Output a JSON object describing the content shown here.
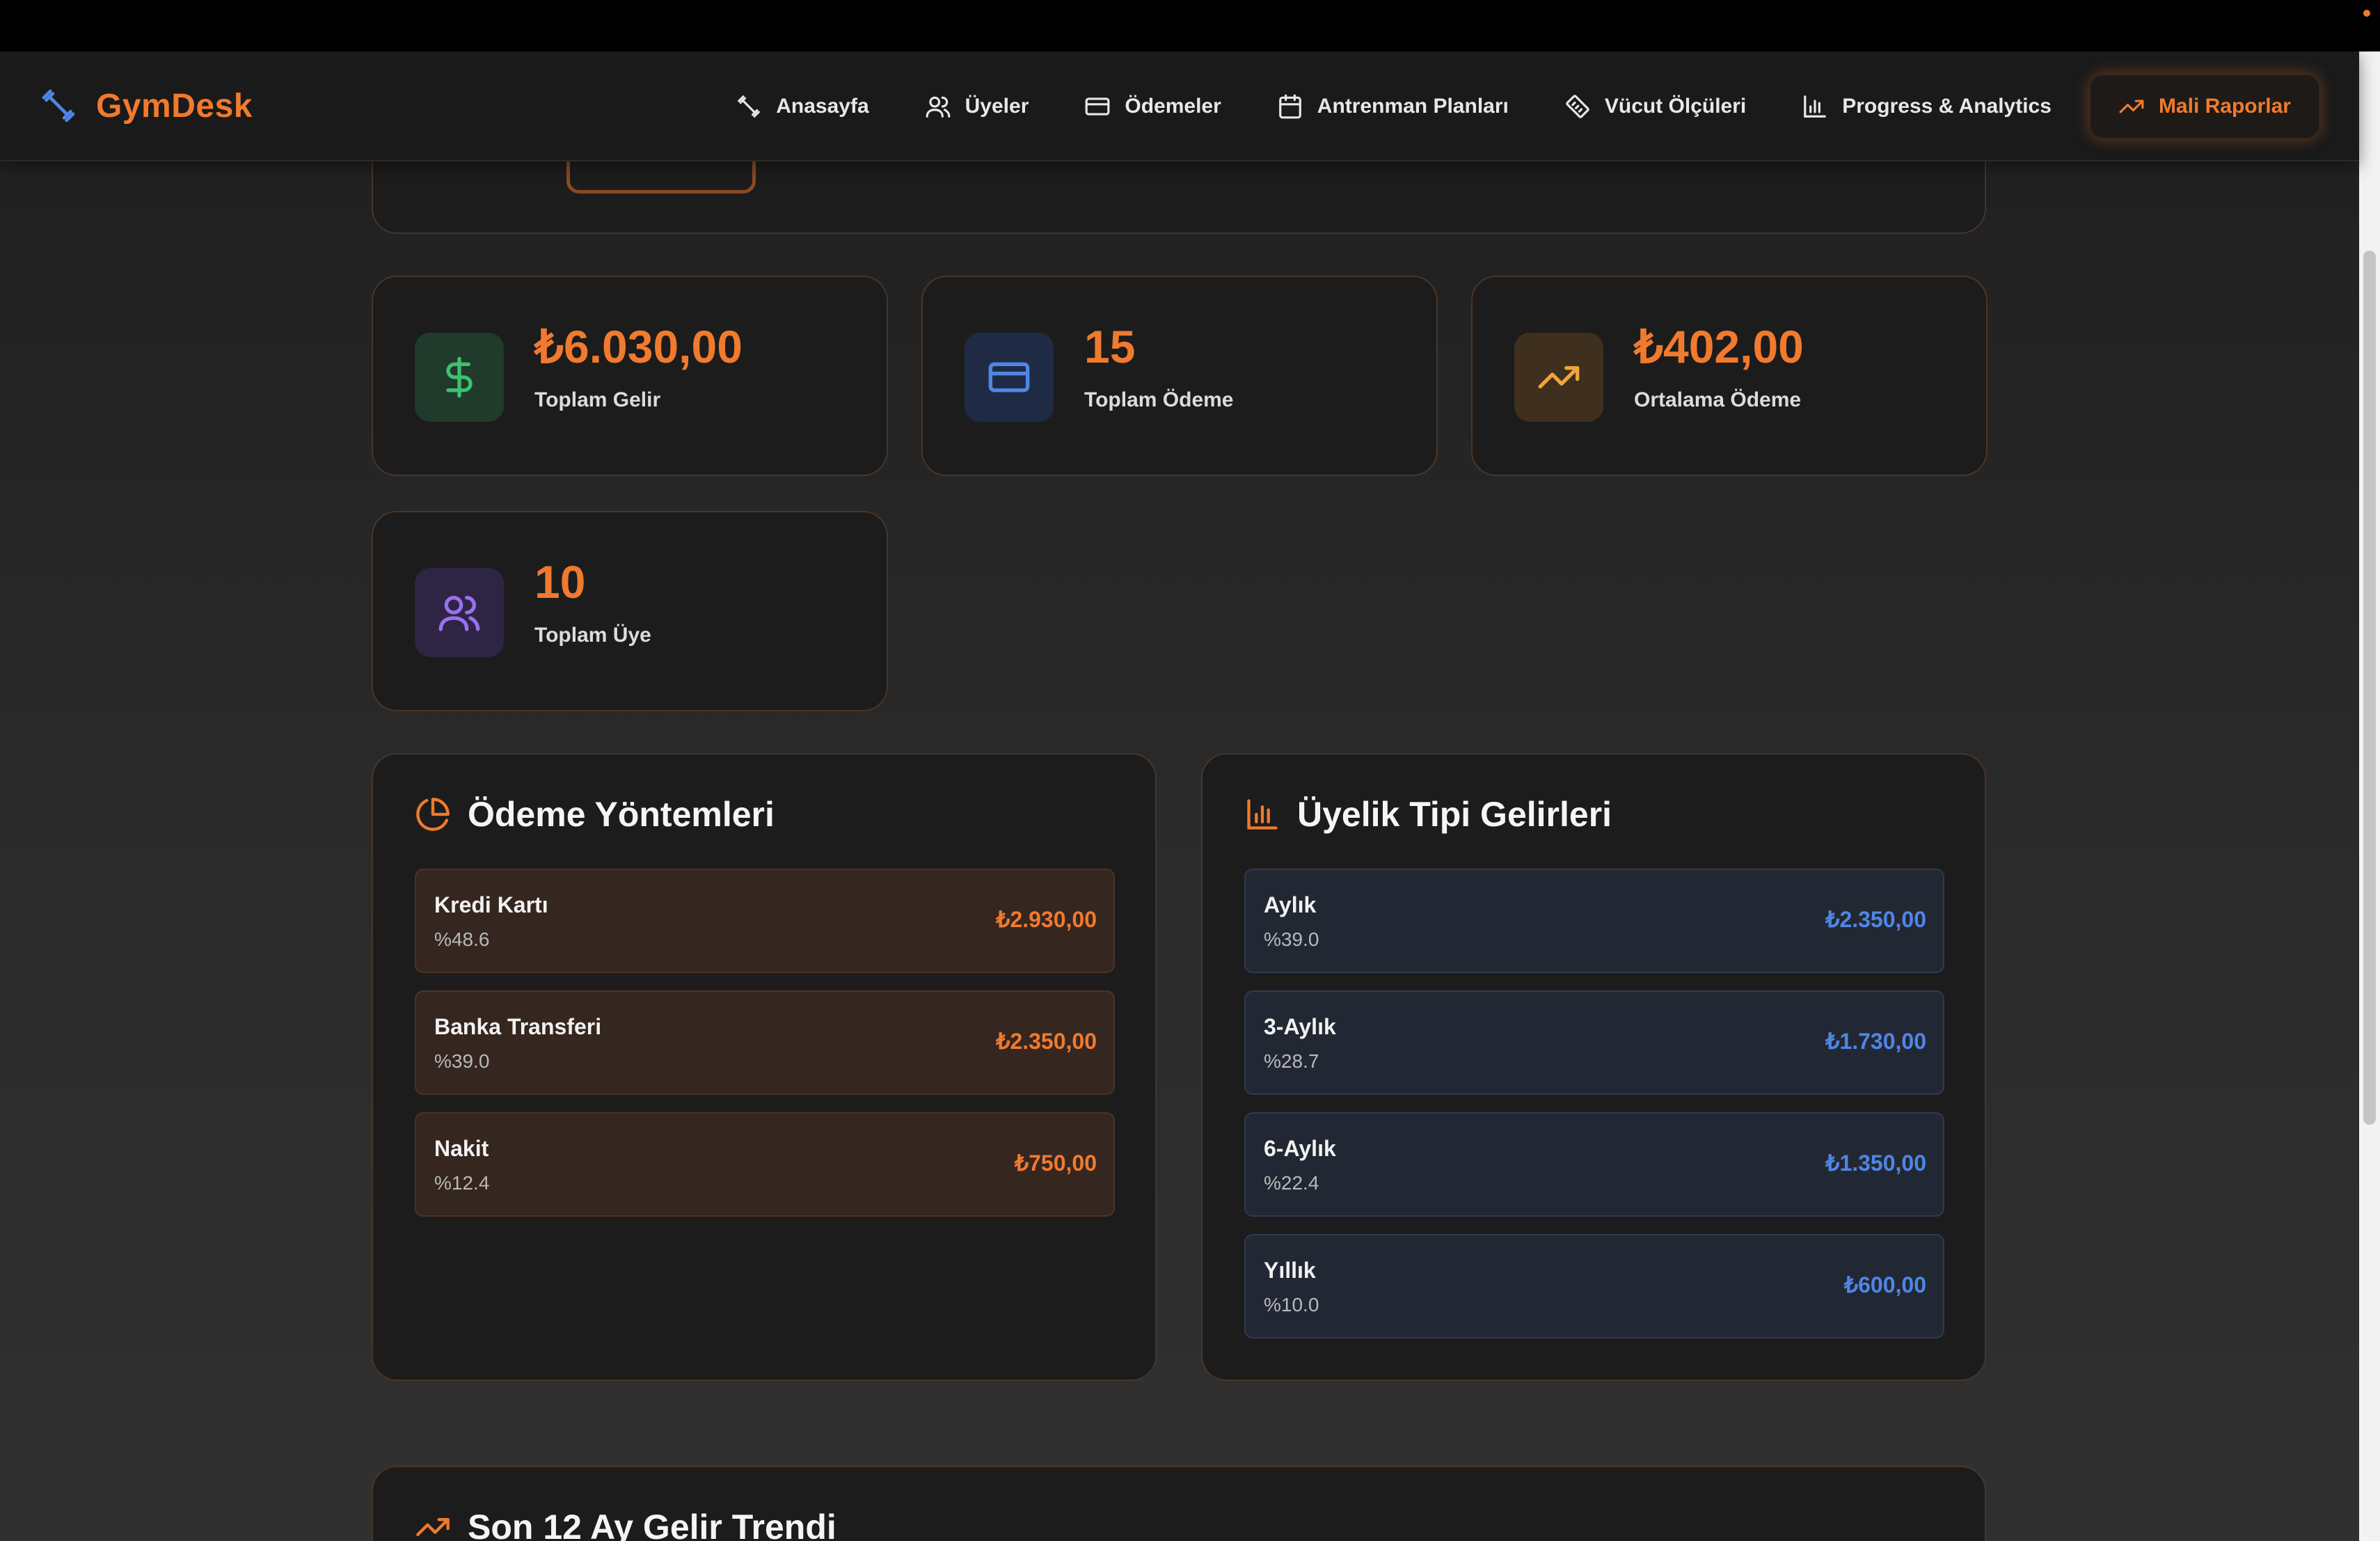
{
  "brand": {
    "name": "GymDesk",
    "color": "#f07a2e"
  },
  "nav": {
    "items": [
      {
        "label": "Anasayfa",
        "icon": "dumbbell-icon"
      },
      {
        "label": "Üyeler",
        "icon": "users-icon"
      },
      {
        "label": "Ödemeler",
        "icon": "credit-card-icon"
      },
      {
        "label": "Antrenman Planları",
        "icon": "calendar-icon"
      },
      {
        "label": "Vücut Ölçüleri",
        "icon": "ruler-icon"
      },
      {
        "label": "Progress & Analytics",
        "icon": "bar-chart-icon"
      },
      {
        "label": "Mali Raporlar",
        "icon": "trending-up-icon",
        "active": true
      }
    ]
  },
  "stats": [
    {
      "value": "₺6.030,00",
      "label": "Toplam Gelir",
      "icon": "dollar-icon",
      "accent": "#3fbf6f"
    },
    {
      "value": "15",
      "label": "Toplam Ödeme",
      "icon": "credit-card-icon",
      "accent": "#4f86e6"
    },
    {
      "value": "₺402,00",
      "label": "Ortalama Ödeme",
      "icon": "trending-up-icon",
      "accent": "#f0a53a"
    },
    {
      "value": "10",
      "label": "Toplam Üye",
      "icon": "users-icon",
      "accent": "#9a6ff0"
    }
  ],
  "payment_methods": {
    "title": "Ödeme Yöntemleri",
    "icon": "pie-chart-icon",
    "rows": [
      {
        "name": "Kredi Kartı",
        "pct": "%48.6",
        "amount": "₺2.930,00"
      },
      {
        "name": "Banka Transferi",
        "pct": "%39.0",
        "amount": "₺2.350,00"
      },
      {
        "name": "Nakit",
        "pct": "%12.4",
        "amount": "₺750,00"
      }
    ]
  },
  "membership_income": {
    "title": "Üyelik Tipi Gelirleri",
    "icon": "bar-chart-icon",
    "rows": [
      {
        "name": "Aylık",
        "pct": "%39.0",
        "amount": "₺2.350,00"
      },
      {
        "name": "3-Aylık",
        "pct": "%28.7",
        "amount": "₺1.730,00"
      },
      {
        "name": "6-Aylık",
        "pct": "%22.4",
        "amount": "₺1.350,00"
      },
      {
        "name": "Yıllık",
        "pct": "%10.0",
        "amount": "₺600,00"
      }
    ]
  },
  "trend": {
    "title": "Son 12 Ay Gelir Trendi",
    "icon": "trending-up-icon"
  }
}
